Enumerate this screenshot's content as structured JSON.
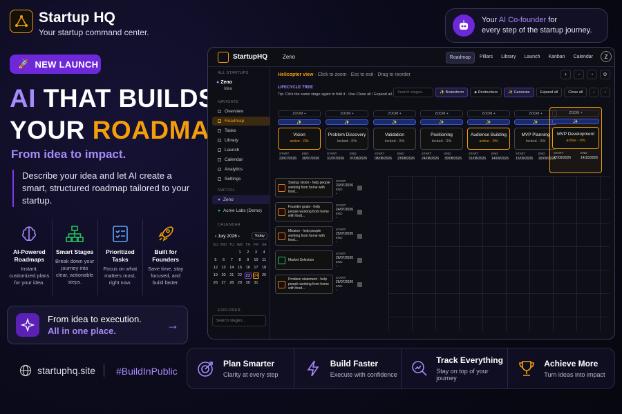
{
  "brand": {
    "name": "Startup HQ",
    "tagline": "Your startup command center."
  },
  "cofounder": {
    "pre": "Your ",
    "hl": "AI Co-founder",
    "post": " for",
    "line2": "every step of the startup journey."
  },
  "badge": "NEW LAUNCH",
  "hero": {
    "line1a": "AI",
    "line1b": " THAT BUILDS",
    "line2a": "YOUR ",
    "line2b": "ROADMAP.",
    "sub": "From idea to impact.",
    "desc": "Describe your idea and let AI create a smart, structured roadmap tailored to your startup."
  },
  "features": [
    {
      "title": "AI-Powered Roadmaps",
      "desc": "Instant, customized plans for your idea.",
      "icon": "brain-icon"
    },
    {
      "title": "Smart Stages",
      "desc": "Break down your journey into clear, actionable steps.",
      "icon": "hierarchy-icon"
    },
    {
      "title": "Prioritized Tasks",
      "desc": "Focus on what matters most, right now.",
      "icon": "checklist-icon"
    },
    {
      "title": "Built for Founders",
      "desc": "Save time, stay focused, and build faster.",
      "icon": "rocket-icon"
    }
  ],
  "cta": {
    "line1": "From idea to execution.",
    "line2": "All in one place."
  },
  "footer": {
    "site": "startuphq.site",
    "hashtag": "#BuildInPublic"
  },
  "benefits": [
    {
      "title": "Plan Smarter",
      "desc": "Clarity at every step",
      "icon": "target-icon"
    },
    {
      "title": "Build Faster",
      "desc": "Execute with confidence",
      "icon": "lightning-icon"
    },
    {
      "title": "Track Everything",
      "desc": "Stay on top of your journey",
      "icon": "chart-icon"
    },
    {
      "title": "Achieve More",
      "desc": "Turn ideas into impact",
      "icon": "trophy-icon"
    }
  ],
  "app": {
    "name": "StartupHQ",
    "project": "Zeno",
    "tabs": [
      "Roadmap",
      "Pillars",
      "Library",
      "Launch",
      "Kanban",
      "Calendar"
    ],
    "avatar": "Z",
    "sidebar": {
      "all_startups": "ALL STARTUPS",
      "current": "Zeno",
      "current_sub": "Idea",
      "navigate": "NAVIGATE",
      "nav": [
        "Overview",
        "Roadmap",
        "Tasks",
        "Library",
        "Launch",
        "Calendar",
        "Analytics",
        "Settings"
      ],
      "switch": "SWITCH",
      "switch_items": [
        "Zeno",
        "Acme Labs (Demo)"
      ],
      "calendar": "CALENDAR",
      "month": "July 2026",
      "today": "Today",
      "weekdays": [
        "SU",
        "MO",
        "TU",
        "WE",
        "TH",
        "FR",
        "SA"
      ],
      "days": [
        "",
        "",
        "",
        "1",
        "2",
        "3",
        "4",
        "5",
        "6",
        "7",
        "8",
        "9",
        "10",
        "11",
        "12",
        "13",
        "14",
        "15",
        "16",
        "17",
        "18",
        "19",
        "20",
        "21",
        "22",
        "23",
        "24",
        "25",
        "26",
        "27",
        "28",
        "29",
        "30",
        "31",
        ""
      ],
      "explorer": "EXPLORER",
      "search_placeholder": "Search stages..."
    },
    "header": {
      "heli": "Helicopter view",
      "hint": " · Click to zoom · Esc to exit · Drag to reorder",
      "lifecycle": "LIFECYCLE TREE",
      "tip": "Tip: Click the same stage again to fold it · Use Close all / Expand all."
    },
    "toolbar": {
      "search": "Search stages...",
      "brainstorm": "✨ Brainstorm",
      "restructure": "◈ Restructure",
      "generate": "✨ Generate",
      "expand": "Expand all",
      "close": "Close all"
    },
    "stages": [
      {
        "zoom": "ZOOM +",
        "name": "Vision",
        "status": "active - 0%",
        "active": true,
        "start": "23/07/2026",
        "end": "30/07/2026"
      },
      {
        "zoom": "ZOOM +",
        "name": "Problem Discovery",
        "status": "locked - 0%",
        "active": false,
        "start": "31/07/2026",
        "end": "07/08/2026"
      },
      {
        "zoom": "ZOOM +",
        "name": "Validation",
        "status": "locked - 0%",
        "active": false,
        "start": "08/08/2026",
        "end": "23/08/2026"
      },
      {
        "zoom": "ZOOM +",
        "name": "Positioning",
        "status": "locked - 0%",
        "active": false,
        "start": "24/08/2026",
        "end": "30/08/2026"
      },
      {
        "zoom": "ZOOM +",
        "name": "Audience Building",
        "status": "active - 0%",
        "active": true,
        "start": "31/08/2026",
        "end": "14/09/2026"
      },
      {
        "zoom": "ZOOM +",
        "name": "MVP Planning",
        "status": "locked - 0%",
        "active": false,
        "start": "15/09/2026",
        "end": "26/09/2026"
      },
      {
        "zoom": "ZOOM +",
        "name": "MVP Development",
        "status": "active - 0%",
        "active": true,
        "start": "27/09/2026",
        "end": "14/10/2026"
      }
    ],
    "tasks": [
      {
        "title": "Startup vision - help people working from home with food...",
        "start": "23/07/2026",
        "end": "-"
      },
      {
        "title": "Founder goals - help people working from home with food...",
        "start": "24/07/2026",
        "end": "-"
      },
      {
        "title": "Mission - help people working from home with food...",
        "start": "25/07/2026",
        "end": "-"
      },
      {
        "title": "Market Selection",
        "start": "26/07/2026",
        "end": "-"
      },
      {
        "title": "Problem statement - help people working from home with food...",
        "start": "26/07/2026",
        "end": "-"
      }
    ]
  }
}
